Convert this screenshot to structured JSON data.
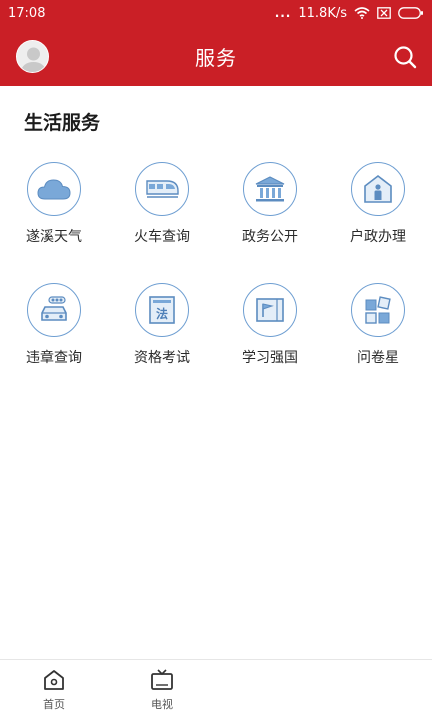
{
  "status_bar": {
    "time": "17:08",
    "dots": "...",
    "speed": "11.8K/s"
  },
  "nav": {
    "title": "服务"
  },
  "section": {
    "title": "生活服务"
  },
  "services": [
    {
      "label": "遂溪天气",
      "icon": "cloud-icon"
    },
    {
      "label": "火车查询",
      "icon": "train-icon"
    },
    {
      "label": "政务公开",
      "icon": "government-building-icon"
    },
    {
      "label": "户政办理",
      "icon": "house-person-icon"
    },
    {
      "label": "违章查询",
      "icon": "car-traffic-light-icon"
    },
    {
      "label": "资格考试",
      "icon": "law-book-icon"
    },
    {
      "label": "学习强国",
      "icon": "flag-book-icon"
    },
    {
      "label": "问卷星",
      "icon": "blocks-icon"
    }
  ],
  "tabs": [
    {
      "label": "首页",
      "icon": "home-icon"
    },
    {
      "label": "电视",
      "icon": "tv-icon"
    }
  ],
  "colors": {
    "brand_red": "#ca1f26",
    "icon_blue": "#6f9fd2"
  }
}
